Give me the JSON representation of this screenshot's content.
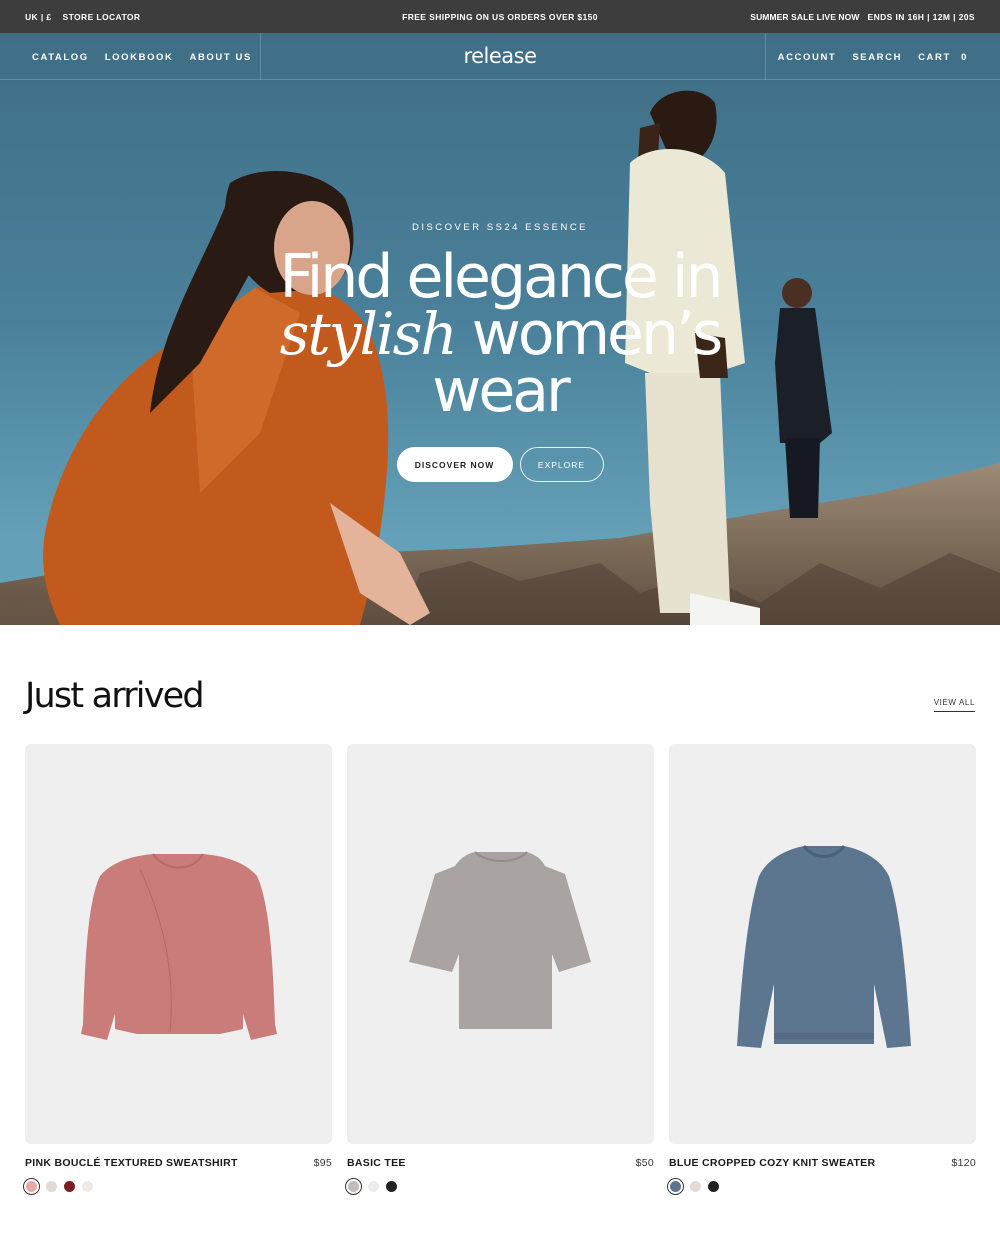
{
  "announcement": {
    "locale": "UK | £",
    "store_locator": "STORE LOCATOR",
    "shipping": "FREE SHIPPING ON US ORDERS OVER $150",
    "sale": "SUMMER SALE LIVE NOW",
    "countdown": "ENDS IN 16H | 12M | 20S"
  },
  "nav": {
    "left": [
      "CATALOG",
      "LOOKBOOK",
      "ABOUT US"
    ],
    "logo": "release",
    "right": [
      "ACCOUNT",
      "SEARCH",
      "CART"
    ],
    "cart_count": "0"
  },
  "hero": {
    "eyebrow": "DISCOVER SS24 ESSENCE",
    "headline_line1": "Find elegance in",
    "headline_serif": "stylish",
    "headline_line2_rest": " women’s",
    "headline_line3": "wear",
    "primary_cta": "DISCOVER NOW",
    "secondary_cta": "EXPLORE",
    "colors": {
      "sky": "#4a7e98",
      "coat_orange": "#c25a1e",
      "suit_cream": "#ece8d6",
      "suit_black": "#1b1f28",
      "rocks": "#7a6a58"
    }
  },
  "section": {
    "title": "Just arrived",
    "view_all": "VIEW ALL"
  },
  "products": [
    {
      "name": "PINK BOUCLÉ TEXTURED SWEATSHIRT",
      "price": "$95",
      "image_icon": "pink-sweatshirt",
      "garment_color": "#c97c7a",
      "swatches": [
        "#e8a9a6",
        "#e2d9d3",
        "#7a1f22",
        "#efe8e3"
      ],
      "selected_swatch": 0
    },
    {
      "name": "BASIC TEE",
      "price": "$50",
      "image_icon": "grey-tee",
      "garment_color": "#a8a2a0",
      "swatches": [
        "#c4bcb8",
        "#ececec",
        "#222222"
      ],
      "selected_swatch": 0
    },
    {
      "name": "BLUE CROPPED COZY KNIT SWEATER",
      "price": "$120",
      "image_icon": "blue-sweater",
      "garment_color": "#5d7690",
      "swatches": [
        "#5d7590",
        "#e6dcd6",
        "#222222"
      ],
      "selected_swatch": 0
    }
  ]
}
